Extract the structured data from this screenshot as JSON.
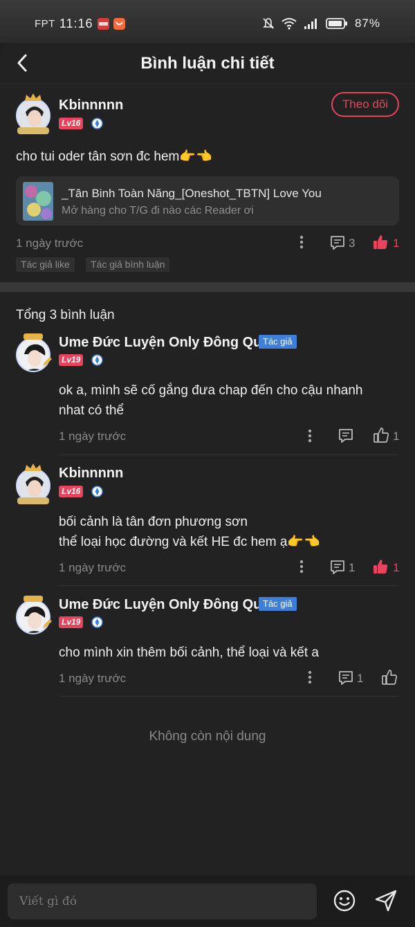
{
  "status_bar": {
    "carrier": "FPT",
    "time": "11:16",
    "battery": "87%"
  },
  "header": {
    "title": "Bình luận chi tiết"
  },
  "post": {
    "username": "Kbinnnnn",
    "level": "Lv16",
    "follow_label": "Theo dõi",
    "text": "cho tui oder tân sơn đc hem👉👈",
    "reference": {
      "title": "_Tân Binh Toàn Năng_[Oneshot_TBTN] Love You",
      "subtitle": "Mở hàng cho T/G đi nào các Reader ơi"
    },
    "time": "1 ngày trước",
    "comment_count": "3",
    "like_count": "1",
    "tags": [
      "Tác giả like",
      "Tác giả bình luận"
    ]
  },
  "total_label": "Tổng 3 bình luận",
  "replies": [
    {
      "username": "Ume Đức Luyện Only Đông Qu...",
      "level": "Lv19",
      "author_tag": "Tác giả",
      "text_lines": [
        "ok a, mình sẽ cố gắng đưa chap đến cho cậu nhanh",
        "nhat có thể"
      ],
      "time": "1 ngày trước",
      "comment_count": "",
      "like_count": "1",
      "liked": false
    },
    {
      "username": "Kbinnnnn",
      "level": "Lv16",
      "author_tag": "",
      "text_lines": [
        "bối cảnh là tân đơn phương sơn",
        "thể loại học đường và kết HE đc hem ạ👉👈"
      ],
      "time": "1 ngày trước",
      "comment_count": "1",
      "like_count": "1",
      "liked": true
    },
    {
      "username": "Ume Đức Luyện Only Đông Qu...",
      "level": "Lv19",
      "author_tag": "Tác giả",
      "text_lines": [
        "cho mình xin thêm bối cảnh, thể loại và kết a"
      ],
      "time": "1 ngày trước",
      "comment_count": "1",
      "like_count": "",
      "liked": false
    }
  ],
  "end_label": "Không còn nội dung",
  "input": {
    "placeholder": "Viết gì đó"
  },
  "colors": {
    "accent": "#e8445e",
    "author_tag": "#3d7fd9",
    "background": "#222222"
  }
}
